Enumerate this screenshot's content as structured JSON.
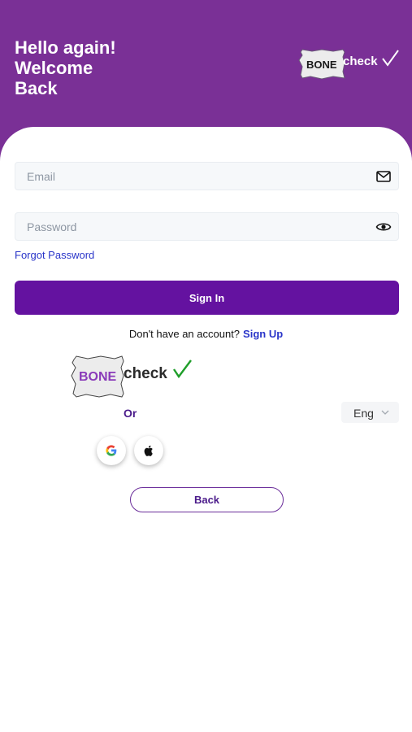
{
  "header": {
    "greeting_line1": "Hello again!",
    "greeting_line2": "Welcome",
    "greeting_line3": "Back",
    "logo_text_bone": "BONE",
    "logo_text_check": "check"
  },
  "form": {
    "email_placeholder": "Email",
    "password_placeholder": "Password",
    "forgot_label": "Forgot Password",
    "signin_label": "Sign In",
    "no_account_text": "Don't have an account?",
    "signup_label": "Sign Up"
  },
  "logo": {
    "bone": "BONE",
    "check": "check"
  },
  "or_label": "Or",
  "language": {
    "selected": "Eng"
  },
  "back_label": "Back",
  "colors": {
    "header_purple": "#7a3096",
    "button_purple": "#6412a0",
    "link_blue": "#2a35c9",
    "check_green": "#1f9e2a"
  },
  "icons": {
    "email": "mail-icon",
    "password": "eye-icon",
    "google": "google-icon",
    "apple": "apple-icon",
    "chevron": "chevron-down-icon"
  }
}
